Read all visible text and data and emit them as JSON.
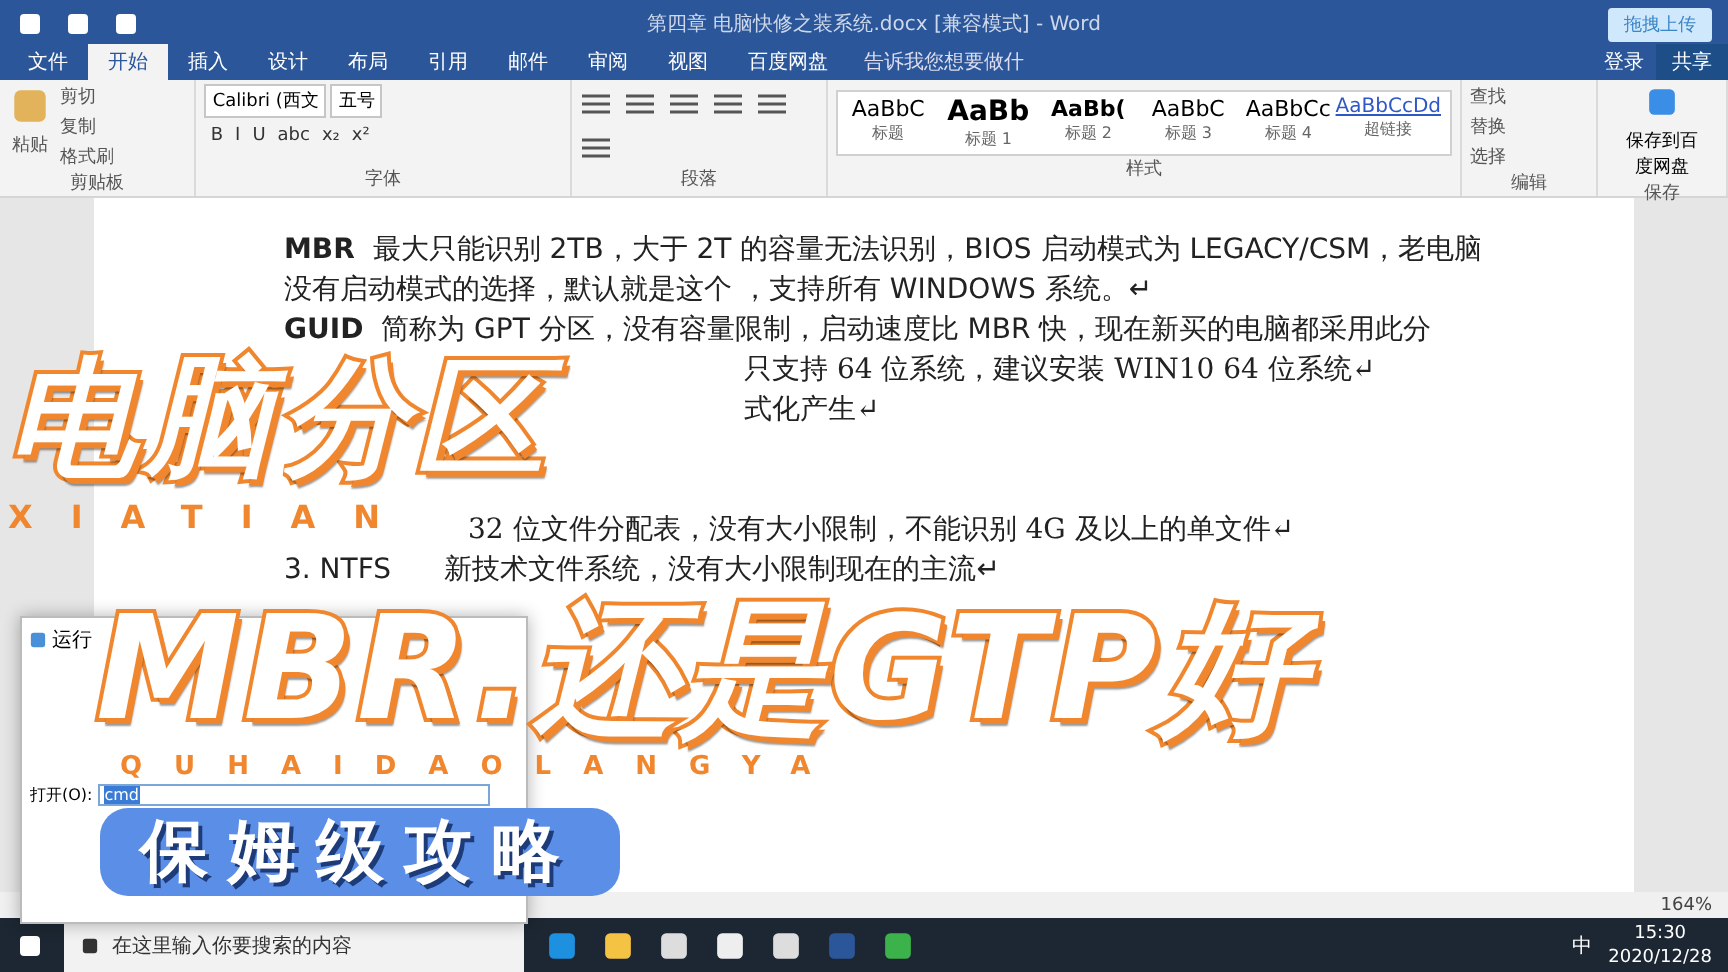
{
  "window": {
    "title": "第四章 电脑快修之装系统.docx [兼容模式] - Word",
    "upload_button": "拖拽上传",
    "login": "登录",
    "share": "共享"
  },
  "tabs": [
    {
      "label": "文件",
      "selected": false
    },
    {
      "label": "开始",
      "selected": true
    },
    {
      "label": "插入",
      "selected": false
    },
    {
      "label": "设计",
      "selected": false
    },
    {
      "label": "布局",
      "selected": false
    },
    {
      "label": "引用",
      "selected": false
    },
    {
      "label": "邮件",
      "selected": false
    },
    {
      "label": "审阅",
      "selected": false
    },
    {
      "label": "视图",
      "selected": false
    },
    {
      "label": "百度网盘",
      "selected": false
    }
  ],
  "tell_me": "告诉我您想要做什",
  "clipboard": {
    "paste": "粘贴",
    "items": [
      "剪切",
      "复制",
      "格式刷"
    ],
    "label": "剪贴板"
  },
  "font": {
    "name": "Calibri (西文",
    "size": "五号",
    "buttons": [
      "B",
      "I",
      "U",
      "abc",
      "x₂",
      "x²"
    ],
    "label": "字体"
  },
  "paragraph": {
    "label": "段落"
  },
  "styles": {
    "items": [
      {
        "sample": "AaBbC",
        "name": "标题",
        "kind": "normal"
      },
      {
        "sample": "AaBb",
        "name": "标题 1",
        "kind": "big"
      },
      {
        "sample": "AaBb(",
        "name": "标题 2",
        "kind": "bold"
      },
      {
        "sample": "AaBbC",
        "name": "标题 3",
        "kind": "normal"
      },
      {
        "sample": "AaBbCc",
        "name": "标题 4",
        "kind": "normal"
      },
      {
        "sample": "AaBbCcDd",
        "name": "超链接",
        "kind": "link"
      }
    ],
    "label": "样式"
  },
  "editing": {
    "items": [
      "查找",
      "替换",
      "选择"
    ],
    "label": "编辑"
  },
  "save": {
    "button": "保存到百度网盘",
    "label": "保存"
  },
  "document": {
    "lines": [
      {
        "kind": "full",
        "text": "**MBR**  最大只能识别 2TB，大于 2T 的容量无法识别，BIOS 启动模式为 LEGACY/CSM，老电脑"
      },
      {
        "kind": "full",
        "text": "没有启动模式的选择，默认就是这个 ，支持所有 WINDOWS 系统。↵"
      },
      {
        "kind": "full",
        "text": "**GUID**  简称为 GPT 分区，没有容量限制，启动速度比 MBR 快，现在新买的电脑都采用此分"
      },
      {
        "kind": "tail",
        "text": "只支持 64 位系统，建议安装 WIN10 64 位系统↵"
      },
      {
        "kind": "tail",
        "text": "式化产生↵"
      },
      {
        "kind": "gap"
      },
      {
        "kind": "gap"
      },
      {
        "kind": "partial",
        "text": "32 位文件分配表，没有大小限制，不能识别 4G 及以上的单文件↵"
      },
      {
        "kind": "full",
        "text": "3. NTFS      新技术文件系统，没有大小限制现在的主流↵"
      }
    ]
  },
  "run_dialog": {
    "title": "运行",
    "open_label": "打开(O):",
    "value": "cmd"
  },
  "status_bar": {
    "zoom": "164%"
  },
  "taskbar": {
    "search_placeholder": "在这里输入你要搜索的内容",
    "ime": "中",
    "time": "15:30",
    "date": "2020/12/28"
  },
  "overlay": {
    "title_line_1": "电脑分区",
    "pinyin_1": "XIATIAN",
    "title_line_2": "MBR.还是GTP好",
    "pinyin_2": "QUHAIDAOLANGYA",
    "badge": "保姆级攻略"
  }
}
